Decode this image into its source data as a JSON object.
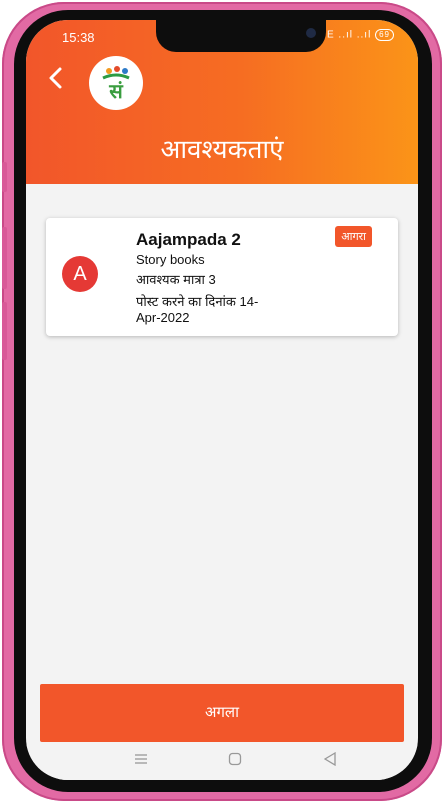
{
  "status_bar": {
    "time": "15:38",
    "signal": "Vo LTE ..ıl ..ıl",
    "battery": "69"
  },
  "header": {
    "title": "आवश्यकताएं",
    "logo_alt": "SAT logo"
  },
  "card": {
    "avatar_letter": "A",
    "title": "Aajampada 2",
    "category": "Story books",
    "quantity": "आवश्यक मात्रा 3",
    "post_date_line1": "पोस्ट करने का दिनांक  14-",
    "post_date_line2": "Apr-2022",
    "location": "आगरा"
  },
  "footer": {
    "next_label": "अगला"
  },
  "colors": {
    "accent": "#f2562a",
    "accent_end": "#fb9418",
    "avatar": "#e53935"
  },
  "icons": {
    "back": "chevron-left-icon",
    "nav_menu": "menu-icon",
    "nav_home": "square-icon",
    "nav_back": "triangle-back-icon"
  }
}
